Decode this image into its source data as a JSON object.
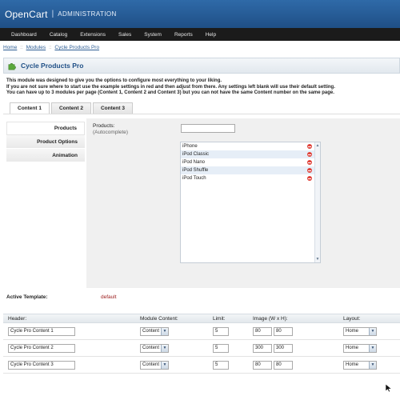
{
  "header": {
    "brand": "OpenCart",
    "separator": "|",
    "subtitle": "ADMINISTRATION"
  },
  "menu": [
    "Dashboard",
    "Catalog",
    "Extensions",
    "Sales",
    "System",
    "Reports",
    "Help"
  ],
  "breadcrumb": {
    "items": [
      "Home",
      "Modules",
      "Cycle Products Pro"
    ],
    "separator": "::"
  },
  "page": {
    "title": "Cycle Products Pro"
  },
  "description": [
    "This module was designed to give you the options to configure most everything to your liking.",
    "If you are not sure where to start use the example settings in red and then adjust from there. Any settings left blank will use their default setting.",
    "You can have up to 3 modules per page (Content 1, Content 2 and Content 3) but you can not have the same Content number on the same page."
  ],
  "tabs": [
    "Content 1",
    "Content 2",
    "Content 3"
  ],
  "vtabs": [
    "Products",
    "Product Options",
    "Animation"
  ],
  "products": {
    "label": "Products:",
    "sublabel": "(Autocomplete)",
    "items": [
      "iPhone",
      "iPod Classic",
      "iPod Nano",
      "iPod Shuffle",
      "iPod Touch"
    ]
  },
  "active_template": {
    "label": "Active Template:",
    "value": "default"
  },
  "table": {
    "headers": [
      "Header:",
      "Module Content:",
      "Limit:",
      "Image (W x H):",
      "Layout:"
    ],
    "rows": [
      {
        "header": "Cycle Pro Content 1",
        "content": "Content 1",
        "limit": "5",
        "w": "80",
        "h": "80",
        "layout": "Home"
      },
      {
        "header": "Cycle Pro Content 2",
        "content": "Content 2",
        "limit": "5",
        "w": "300",
        "h": "300",
        "layout": "Home"
      },
      {
        "header": "Cycle Pro Content 3",
        "content": "Content 3",
        "limit": "5",
        "w": "80",
        "h": "80",
        "layout": "Home"
      }
    ]
  },
  "colors": {
    "brand_blue": "#1f4f86",
    "menu_bg": "#1b1b1b",
    "accent_red": "#9b1c1c",
    "remove_red": "#e0433b"
  }
}
